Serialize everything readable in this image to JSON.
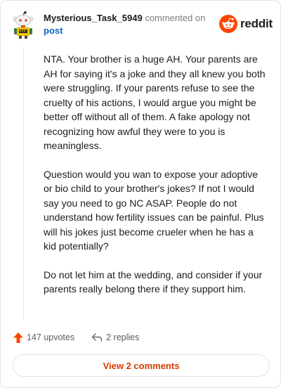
{
  "header": {
    "username": "Mysterious_Task_5949",
    "action_text": "commented on",
    "post_link": "post",
    "brand": "reddit"
  },
  "comment": {
    "paragraphs": [
      "NTA. Your brother is a huge AH. Your parents are AH for saying it's a joke and they all knew you both were struggling. If your parents refuse to see the cruelty of his actions, I would argue you might be better off without all of them. A fake apology not recognizing how awful they were to you is meaningless.",
      "Question would you wan to expose your adoptive or bio child to your brother's jokes? If not I would say you need to go NC ASAP. People do not understand how fertility issues can be painful. Plus will his jokes just become crueler when he has a kid potentially?",
      "Do not let him at the wedding, and consider if your parents really belong there if they support him."
    ]
  },
  "footer": {
    "upvotes": "147 upvotes",
    "replies": "2 replies",
    "view_comments": "View 2 comments"
  },
  "colors": {
    "brand_orange": "#ff4500",
    "link_blue": "#0a66c2",
    "button_text": "#d93a00"
  },
  "icons": {
    "avatar": "snoo-avatar",
    "logo": "reddit-logo-icon",
    "upvote": "upvote-arrow-icon",
    "reply": "reply-arrow-icon"
  }
}
